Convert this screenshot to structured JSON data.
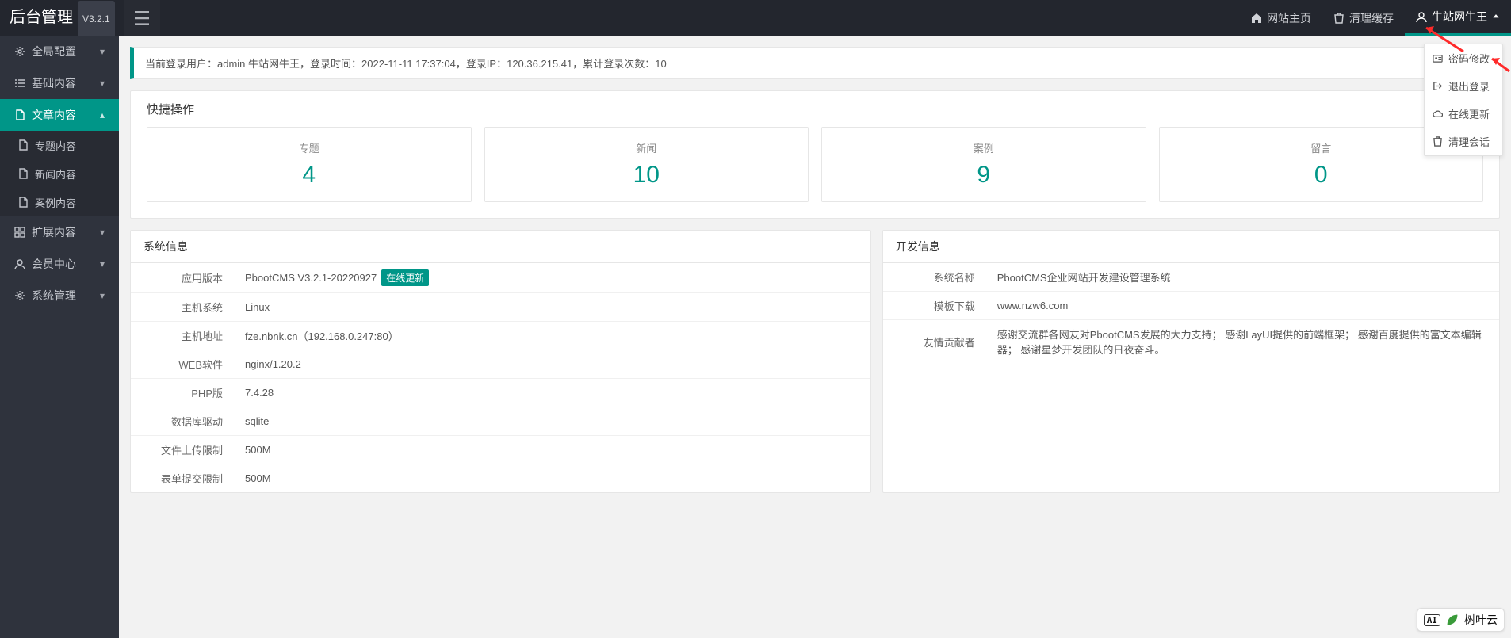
{
  "header": {
    "app_title": "后台管理",
    "version_badge": "V3.2.1",
    "links": {
      "home": "网站主页",
      "clear_cache": "清理缓存",
      "user": "牛站网牛王"
    }
  },
  "sidebar": {
    "items": [
      {
        "icon": "gear",
        "label": "全局配置",
        "expandable": true
      },
      {
        "icon": "list",
        "label": "基础内容",
        "expandable": true
      },
      {
        "icon": "doc",
        "label": "文章内容",
        "expandable": true,
        "open": true,
        "active": true,
        "children": [
          {
            "icon": "doc",
            "label": "专题内容"
          },
          {
            "icon": "doc",
            "label": "新闻内容"
          },
          {
            "icon": "doc",
            "label": "案例内容"
          }
        ]
      },
      {
        "icon": "grid",
        "label": "扩展内容",
        "expandable": true
      },
      {
        "icon": "user",
        "label": "会员中心",
        "expandable": true
      },
      {
        "icon": "gear",
        "label": "系统管理",
        "expandable": true
      }
    ]
  },
  "notice": {
    "text": "当前登录用户：admin 牛站网牛王，登录时间：2022-11-11 17:37:04，登录IP：120.36.215.41，累计登录次数：10"
  },
  "quick": {
    "title": "快捷操作",
    "cards": [
      {
        "label": "专题",
        "value": "4"
      },
      {
        "label": "新闻",
        "value": "10"
      },
      {
        "label": "案例",
        "value": "9"
      },
      {
        "label": "留言",
        "value": "0"
      }
    ]
  },
  "sysinfo": {
    "title": "系统信息",
    "update_badge": "在线更新",
    "rows": [
      {
        "k": "应用版本",
        "v": "PbootCMS V3.2.1-20220927",
        "update": true
      },
      {
        "k": "主机系统",
        "v": "Linux"
      },
      {
        "k": "主机地址",
        "v": "fze.nbnk.cn（192.168.0.247:80）"
      },
      {
        "k": "WEB软件",
        "v": "nginx/1.20.2"
      },
      {
        "k": "PHP版",
        "v": "7.4.28"
      },
      {
        "k": "数据库驱动",
        "v": "sqlite"
      },
      {
        "k": "文件上传限制",
        "v": "500M"
      },
      {
        "k": "表单提交限制",
        "v": "500M"
      }
    ]
  },
  "devinfo": {
    "title": "开发信息",
    "rows": [
      {
        "k": "系统名称",
        "v": "PbootCMS企业网站开发建设管理系统"
      },
      {
        "k": "模板下载",
        "v": "www.nzw6.com"
      },
      {
        "k": "友情贡献者",
        "v": "感谢交流群各网友对PbootCMS发展的大力支持； 感谢LayUI提供的前端框架； 感谢百度提供的富文本编辑器； 感谢星梦开发团队的日夜奋斗。"
      }
    ]
  },
  "dropdown": {
    "items": [
      {
        "icon": "id",
        "label": "密码修改"
      },
      {
        "icon": "logout",
        "label": "退出登录"
      },
      {
        "icon": "cloud",
        "label": "在线更新"
      },
      {
        "icon": "trash",
        "label": "清理会话"
      }
    ]
  },
  "brand": {
    "ai": "AI",
    "name": "树叶云"
  }
}
